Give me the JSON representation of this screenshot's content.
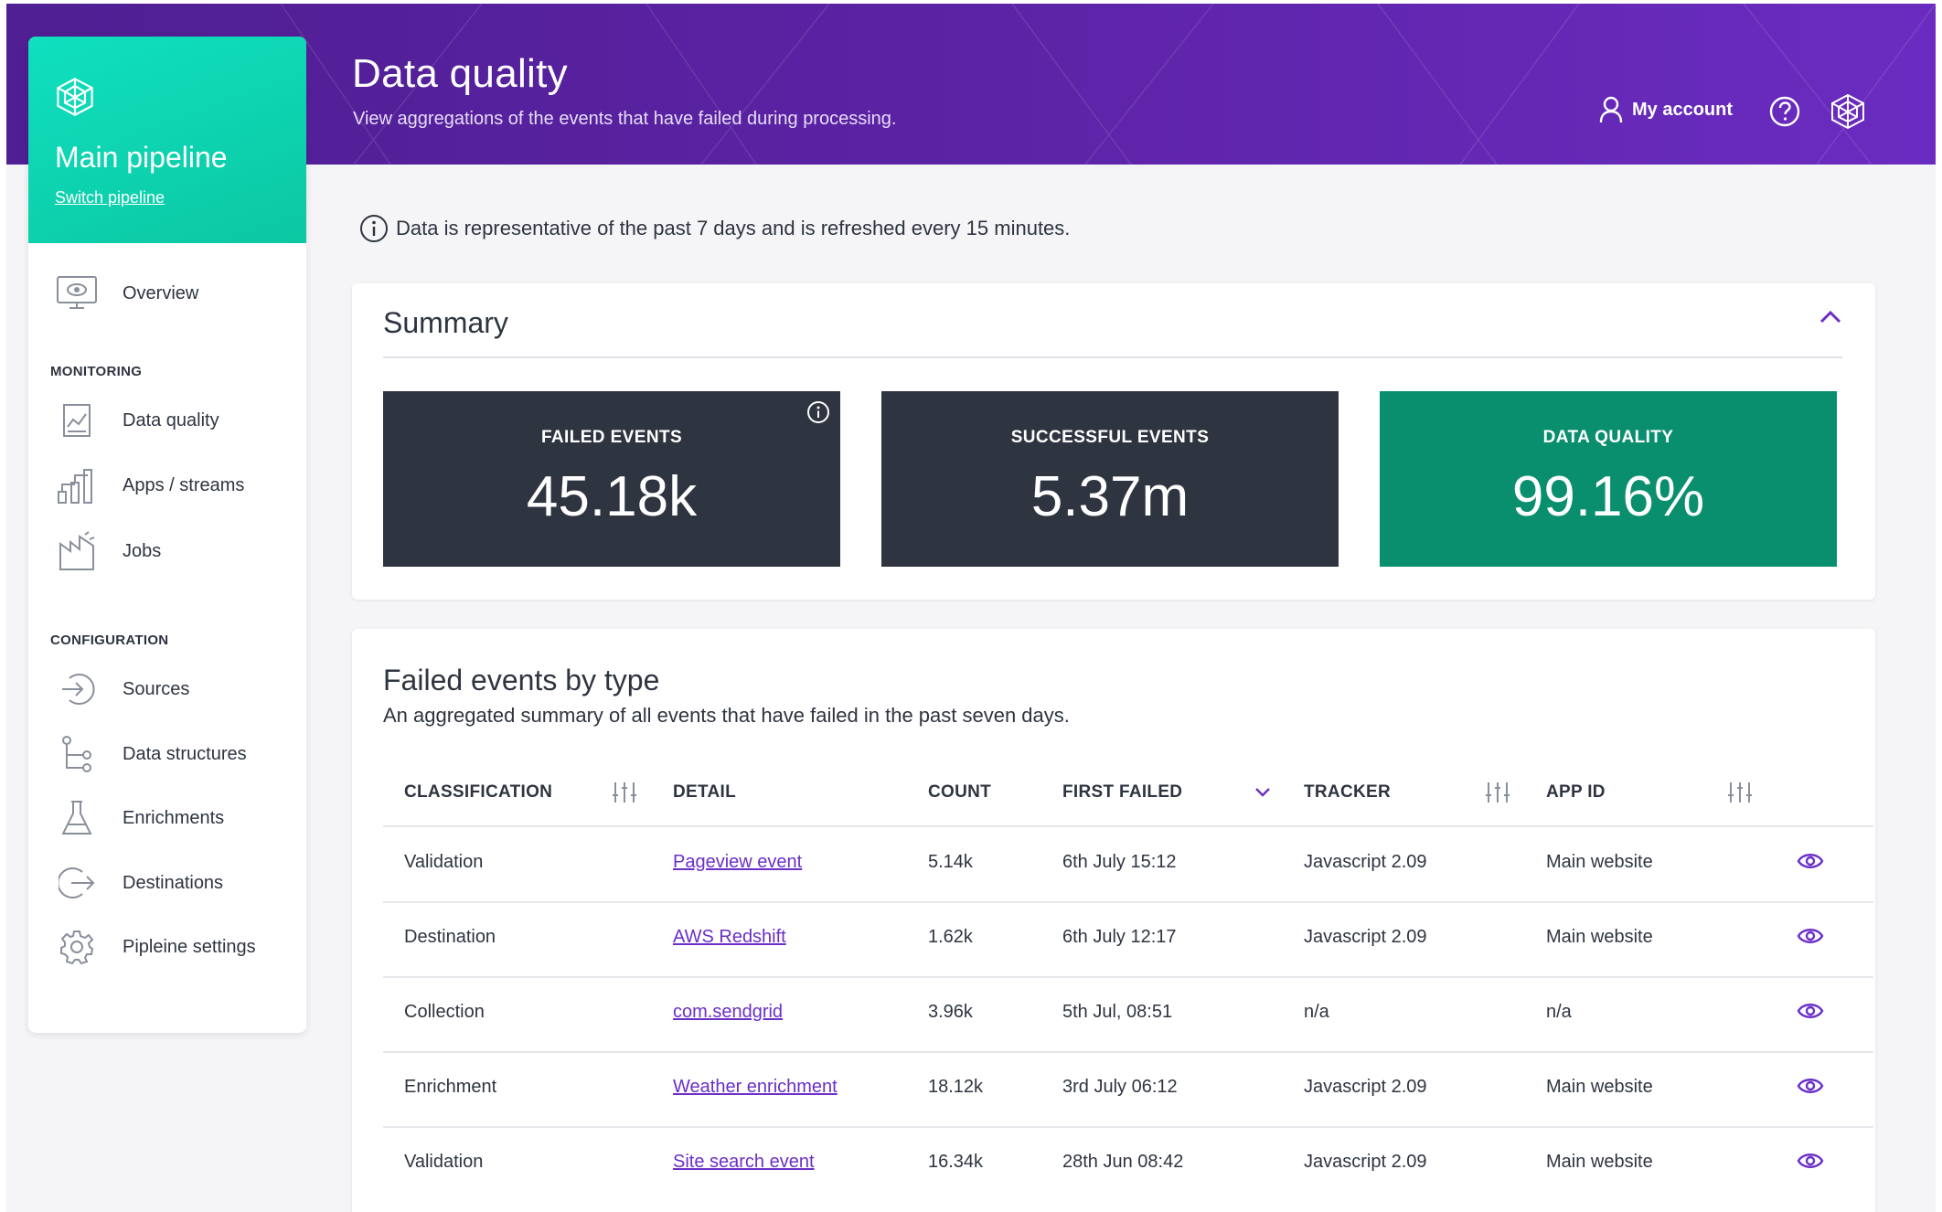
{
  "header": {
    "title": "Data quality",
    "subtitle": "View aggregations of the events that have failed during processing.",
    "account_label": "My account",
    "brand_color": "#5b22a3"
  },
  "sidebar": {
    "pipeline_name": "Main pipeline",
    "switch_label": "Switch pipeline",
    "overview_label": "Overview",
    "monitoring_heading": "MONITORING",
    "monitoring_items": [
      {
        "label": "Data quality",
        "icon": "chart-icon"
      },
      {
        "label": "Apps / streams",
        "icon": "streams-icon"
      },
      {
        "label": "Jobs",
        "icon": "jobs-icon"
      }
    ],
    "configuration_heading": "CONFIGURATION",
    "configuration_items": [
      {
        "label": "Sources",
        "icon": "sign-in-icon"
      },
      {
        "label": "Data structures",
        "icon": "structure-icon"
      },
      {
        "label": "Enrichments",
        "icon": "flask-icon"
      },
      {
        "label": "Destinations",
        "icon": "sign-out-icon"
      },
      {
        "label": "Pipleine settings",
        "icon": "gear-icon"
      }
    ],
    "accent_color": "#0fe0bf"
  },
  "info": {
    "text": "Data is representative of the past 7 days and is refreshed every 15 minutes."
  },
  "summary": {
    "title": "Summary",
    "stats": [
      {
        "label": "FAILED EVENTS",
        "value": "45.18k",
        "color": "#2f3441"
      },
      {
        "label": "SUCCESSFUL EVENTS",
        "value": "5.37m",
        "color": "#2f3441"
      },
      {
        "label": "DATA QUALITY",
        "value": "99.16%",
        "color": "#0a8f6e"
      }
    ]
  },
  "failed_events": {
    "title": "Failed events by type",
    "subtitle": "An aggregated summary of all events that have failed in the past seven days.",
    "columns": [
      "CLASSIFICATION",
      "DETAIL",
      "COUNT",
      "FIRST FAILED",
      "TRACKER",
      "APP ID"
    ],
    "rows": [
      {
        "classification": "Validation",
        "detail": "Pageview event",
        "count": "5.14k",
        "first_failed": "6th July 15:12",
        "tracker": "Javascript 2.09",
        "app_id": "Main website"
      },
      {
        "classification": "Destination",
        "detail": "AWS Redshift",
        "count": "1.62k",
        "first_failed": "6th July 12:17",
        "tracker": "Javascript 2.09",
        "app_id": "Main website"
      },
      {
        "classification": "Collection",
        "detail": "com.sendgrid",
        "count": "3.96k",
        "first_failed": "5th Jul, 08:51",
        "tracker": "n/a",
        "app_id": "n/a"
      },
      {
        "classification": "Enrichment",
        "detail": "Weather enrichment",
        "count": "18.12k",
        "first_failed": "3rd July 06:12",
        "tracker": "Javascript 2.09",
        "app_id": "Main website"
      },
      {
        "classification": "Validation",
        "detail": "Site search event",
        "count": "16.34k",
        "first_failed": "28th Jun 08:42",
        "tracker": "Javascript 2.09",
        "app_id": "Main website"
      }
    ],
    "link_color": "#6b2fc7"
  }
}
